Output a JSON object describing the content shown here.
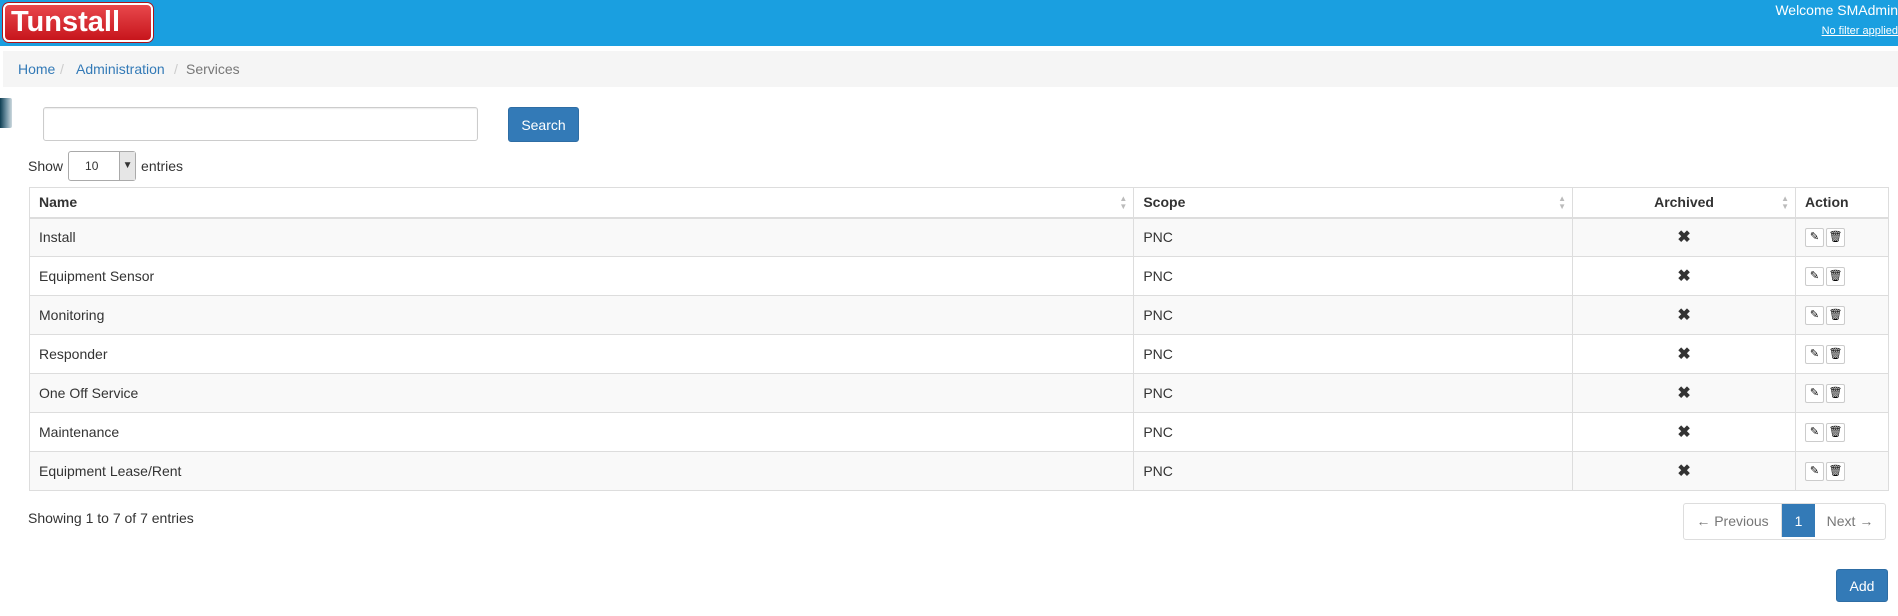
{
  "header": {
    "logo_text": "Tunstall",
    "welcome": "Welcome SMAdmin",
    "filter_link": "No filter applied"
  },
  "breadcrumb": {
    "home": "Home",
    "administration": "Administration",
    "current": "Services",
    "separator": "/"
  },
  "search": {
    "placeholder": "",
    "button_label": "Search"
  },
  "length": {
    "show_label": "Show",
    "selected": "10",
    "entries_label": "entries"
  },
  "table": {
    "columns": [
      "Name",
      "Scope",
      "Archived",
      "Action"
    ],
    "rows": [
      {
        "name": "Install",
        "scope": "PNC"
      },
      {
        "name": "Equipment Sensor",
        "scope": "PNC"
      },
      {
        "name": "Monitoring",
        "scope": "PNC"
      },
      {
        "name": "Responder",
        "scope": "PNC"
      },
      {
        "name": "One Off Service",
        "scope": "PNC"
      },
      {
        "name": "Maintenance",
        "scope": "PNC"
      },
      {
        "name": "Equipment Lease/Rent",
        "scope": "PNC"
      }
    ],
    "archived_icon": "✖",
    "edit_icon": "✎",
    "delete_icon": "🗑"
  },
  "info": "Showing 1 to 7 of 7 entries",
  "pagination": {
    "previous": "← Previous",
    "current": "1",
    "next": "Next →"
  },
  "add_label": "Add",
  "colors": {
    "header": "#1a9fe0",
    "primary": "#337ab7",
    "logo": "#d91f26"
  }
}
